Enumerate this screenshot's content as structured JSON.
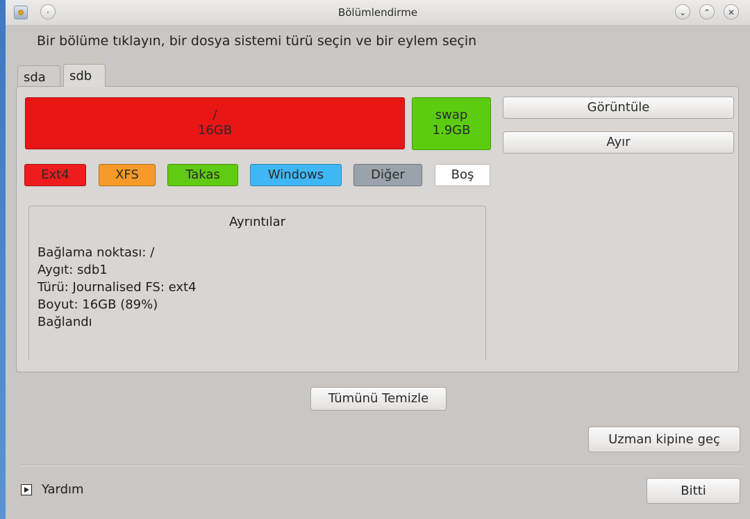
{
  "window": {
    "title": "Bölümlendirme",
    "controls": [
      "chevron-down-icon",
      "chevron-up-icon",
      "close-icon"
    ]
  },
  "instruction": "Bir bölüme tıklayın, bir dosya sistemi türü seçin ve bir eylem seçin",
  "tabs": [
    {
      "label": "sda",
      "active": false
    },
    {
      "label": "sdb",
      "active": true
    }
  ],
  "partitions": [
    {
      "mount": "/",
      "size": "16GB",
      "fs": "ext4",
      "color": "#e81515"
    },
    {
      "mount": "swap",
      "size": "1.9GB",
      "fs": "swap",
      "color": "#5ccc10"
    }
  ],
  "actions": {
    "view": "Görüntüle",
    "unmount": "Ayır"
  },
  "legend": [
    {
      "label": "Ext4",
      "color": "#ee1c1c"
    },
    {
      "label": "XFS",
      "color": "#f79a2a"
    },
    {
      "label": "Takas",
      "color": "#5fcb12"
    },
    {
      "label": "Windows",
      "color": "#3fb7f5"
    },
    {
      "label": "Diğer",
      "color": "#9aa3ab"
    },
    {
      "label": "Boş",
      "color": "#ffffff"
    }
  ],
  "details": {
    "title": "Ayrıntılar",
    "lines": [
      "Bağlama noktası: /",
      "Aygıt: sdb1",
      "Türü: Journalised FS: ext4",
      "Boyut: 16GB (89%)",
      "Bağlandı"
    ]
  },
  "buttons": {
    "clear_all": "Tümünü Temizle",
    "expert_mode": "Uzman kipine geç",
    "done": "Bitti"
  },
  "help": {
    "label": "Yardım"
  }
}
